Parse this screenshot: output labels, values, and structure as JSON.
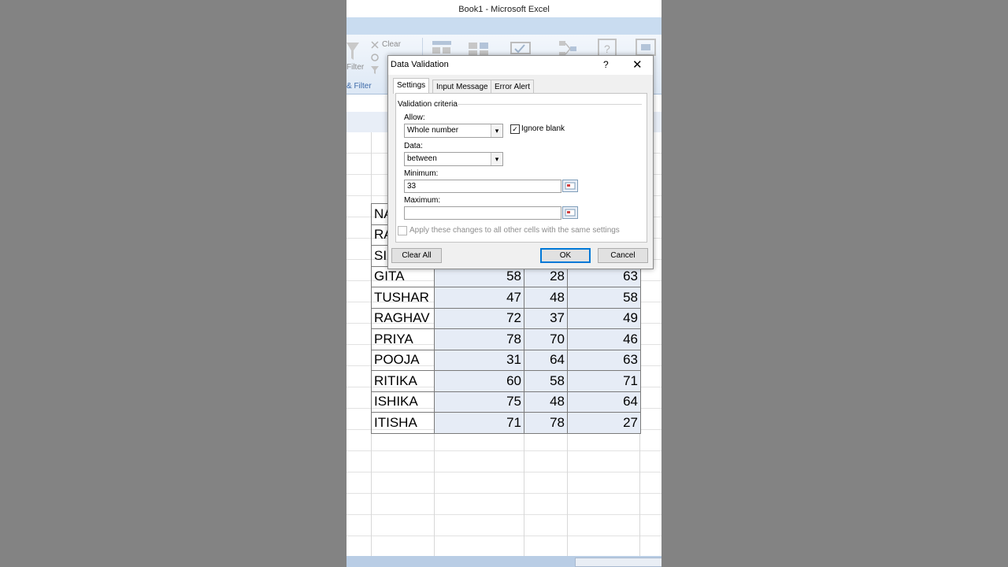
{
  "window": {
    "title": "Book1 - Microsoft Excel"
  },
  "ribbon": {
    "clear_label": "Clear",
    "filter_label": "Filter",
    "group_label": "& Filter"
  },
  "table": {
    "rows": [
      {
        "name": "NA",
        "v1": "",
        "v2": "",
        "v3": ""
      },
      {
        "name": "RA",
        "v1": "",
        "v2": "",
        "v3": ""
      },
      {
        "name": "SI",
        "v1": "",
        "v2": "",
        "v3": ""
      },
      {
        "name": "GITA",
        "v1": "58",
        "v2": "28",
        "v3": "63"
      },
      {
        "name": "TUSHAR",
        "v1": "47",
        "v2": "48",
        "v3": "58"
      },
      {
        "name": "RAGHAV",
        "v1": "72",
        "v2": "37",
        "v3": "49"
      },
      {
        "name": "PRIYA",
        "v1": "78",
        "v2": "70",
        "v3": "46"
      },
      {
        "name": "POOJA",
        "v1": "31",
        "v2": "64",
        "v3": "63"
      },
      {
        "name": "RITIKA",
        "v1": "60",
        "v2": "58",
        "v3": "71"
      },
      {
        "name": "ISHIKA",
        "v1": "75",
        "v2": "48",
        "v3": "64"
      },
      {
        "name": "ITISHA",
        "v1": "71",
        "v2": "78",
        "v3": "27"
      }
    ]
  },
  "dialog": {
    "title": "Data Validation",
    "help": "?",
    "close": "✕",
    "tabs": [
      {
        "label": "Settings"
      },
      {
        "label": "Input Message"
      },
      {
        "label": "Error Alert"
      }
    ],
    "section_label": "Validation criteria",
    "allow_label": "Allow:",
    "allow_value": "Whole number",
    "ignore_blank_label": "Ignore blank",
    "ignore_blank_checked": "✓",
    "data_label": "Data:",
    "data_value": "between",
    "minimum_label": "Minimum:",
    "minimum_value": "33",
    "maximum_label": "Maximum:",
    "maximum_value": "",
    "apply_all_label": "Apply these changes to all other cells with the same settings",
    "clear_all_label": "Clear All",
    "ok_label": "OK",
    "cancel_label": "Cancel"
  },
  "icons": {
    "dropdown_arrow": "▾",
    "ref_picker": "range-picker-icon"
  }
}
